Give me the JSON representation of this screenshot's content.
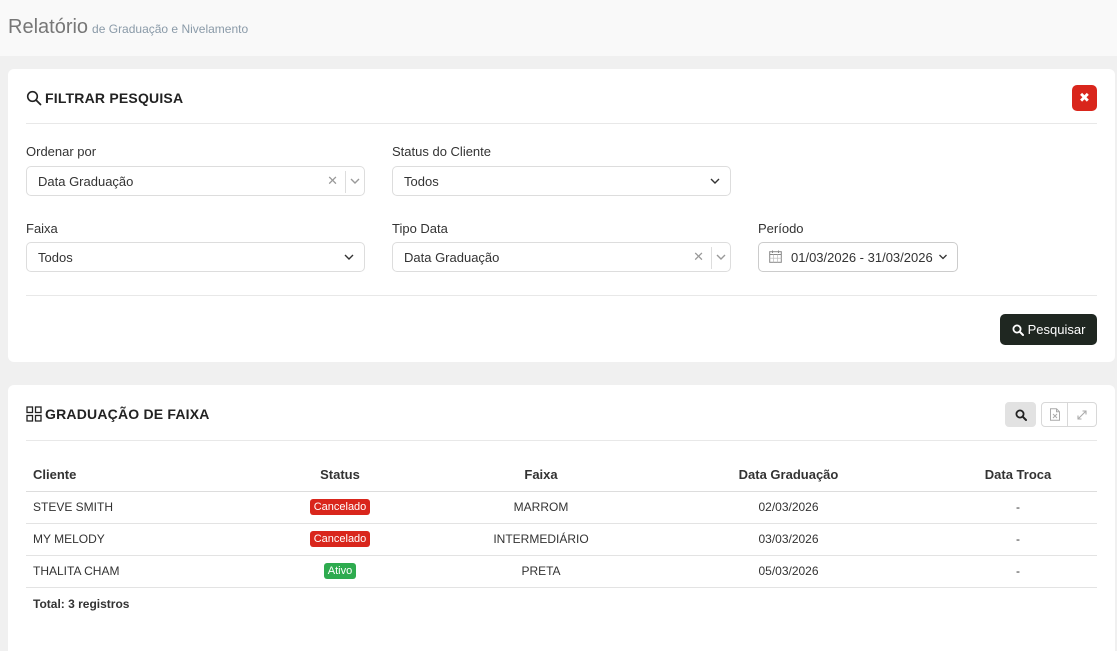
{
  "header": {
    "title": "Relatório",
    "subtitle": "de Graduação e Nivelamento"
  },
  "filter": {
    "title": "FILTRAR PESQUISA",
    "close_label": "✖",
    "order_by": {
      "label": "Ordenar por",
      "value": "Data Graduação"
    },
    "client_status": {
      "label": "Status do Cliente",
      "value": "Todos"
    },
    "belt": {
      "label": "Faixa",
      "value": "Todos"
    },
    "date_type": {
      "label": "Tipo Data",
      "value": "Data Graduação"
    },
    "period": {
      "label": "Período",
      "value": "01/03/2026 - 31/03/2026"
    },
    "search_button": "Pesquisar"
  },
  "results": {
    "title": "GRADUAÇÃO DE FAIXA",
    "columns": [
      "Cliente",
      "Status",
      "Faixa",
      "Data Graduação",
      "Data Troca"
    ],
    "rows": [
      {
        "cliente": "STEVE SMITH",
        "status": "Cancelado",
        "faixa": "MARROM",
        "data_graduacao": "02/03/2026",
        "data_troca": "-"
      },
      {
        "cliente": "MY MELODY",
        "status": "Cancelado",
        "faixa": "INTERMEDIÁRIO",
        "data_graduacao": "03/03/2026",
        "data_troca": "-"
      },
      {
        "cliente": "THALITA CHAM",
        "status": "Ativo",
        "faixa": "PRETA",
        "data_graduacao": "05/03/2026",
        "data_troca": "-"
      }
    ],
    "total": "Total: 3 registros"
  },
  "colors": {
    "danger": "#d9261c",
    "success": "#2eab4f",
    "dark_button": "#1f2721"
  }
}
